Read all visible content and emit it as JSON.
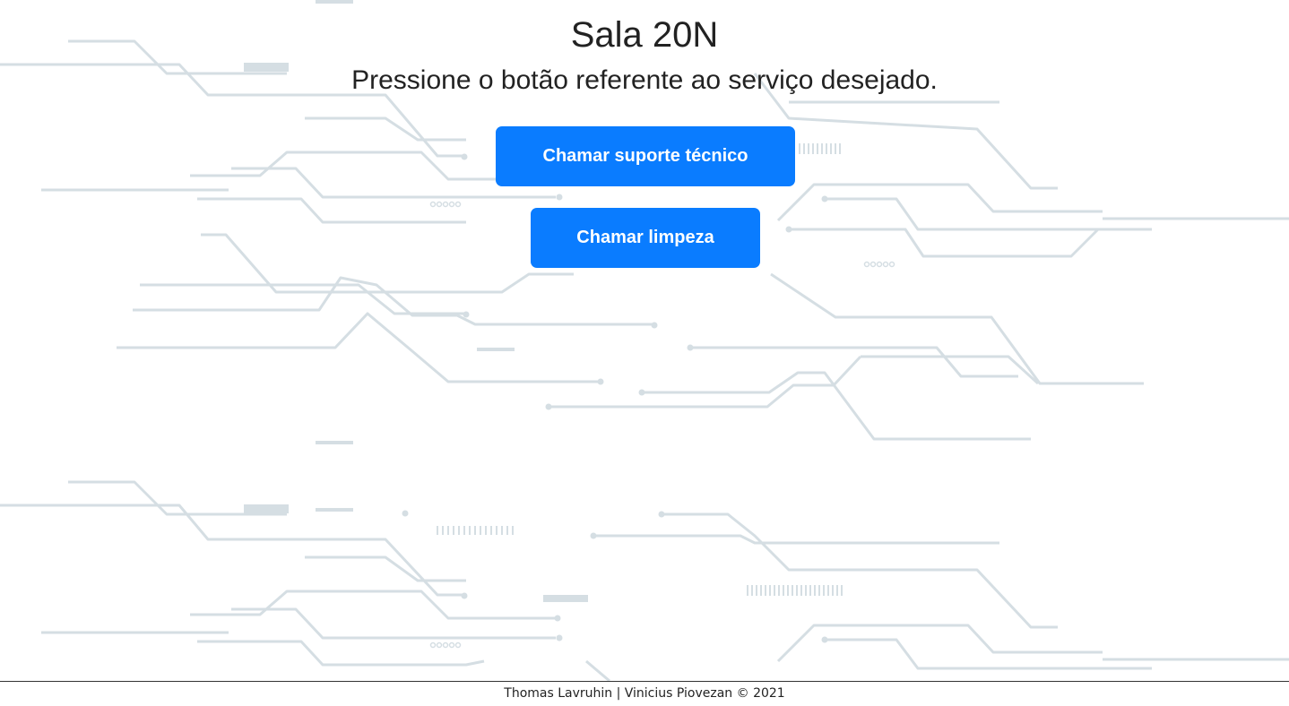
{
  "header": {
    "title": "Sala 20N",
    "subtitle": "Pressione o botão referente ao serviço desejado."
  },
  "actions": {
    "support_label": "Chamar suporte técnico",
    "cleaning_label": "Chamar limpeza"
  },
  "footer": {
    "credits": "Thomas Lavruhin | Vinicius Piovezan © 2021"
  },
  "colors": {
    "button": "#0a7cff",
    "button_text": "#ffffff",
    "circuit": "#d5dee3",
    "text": "#222222"
  },
  "background": {
    "pattern": "circuit-board-lines"
  }
}
